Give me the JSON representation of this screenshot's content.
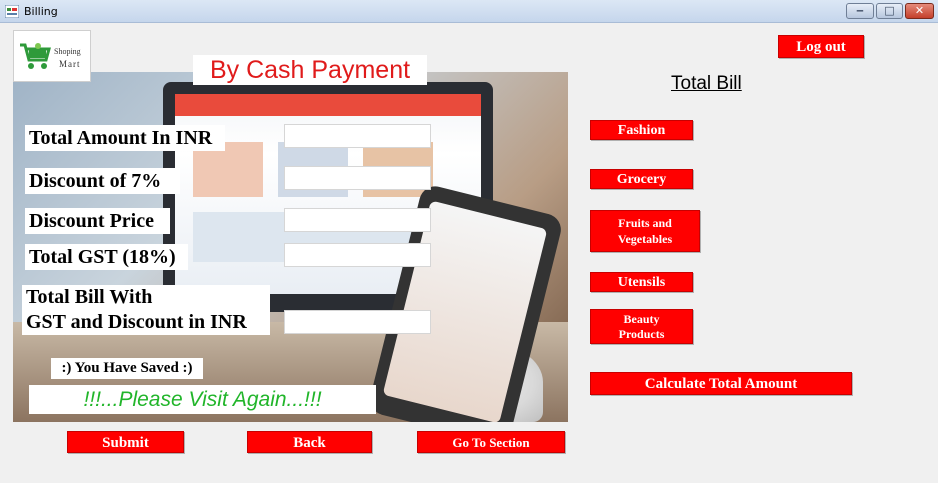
{
  "window": {
    "title": "Billing",
    "min_glyph": "‒",
    "max_glyph": "□",
    "close_glyph": "✕"
  },
  "logo": {
    "line1": "Shoping",
    "line2": "Mart"
  },
  "heading": "By Cash Payment",
  "fields": [
    {
      "label": "Total Amount In INR",
      "value": ""
    },
    {
      "label": "Discount of 7%",
      "value": ""
    },
    {
      "label": "Discount Price",
      "value": ""
    },
    {
      "label": "Total GST (18%)",
      "value": ""
    },
    {
      "label_line1": "Total Bill With",
      "label_line2": "GST and Discount in INR",
      "value": ""
    }
  ],
  "saved_text": ":) You Have Saved :)",
  "visit_text": "!!!...Please Visit Again...!!!",
  "buttons": {
    "submit": "Submit",
    "back": "Back",
    "go_to_section": "Go To Section",
    "logout": "Log out",
    "calculate": "Calculate Total Amount"
  },
  "total_bill_heading": "Total Bill",
  "categories": {
    "fashion": "Fashion",
    "grocery": "Grocery",
    "fruits_line1": "Fruits and",
    "fruits_line2": "Vegetables",
    "utensils": "Utensils",
    "beauty_line1": "Beauty",
    "beauty_line2": "Products"
  },
  "colors": {
    "accent_red": "#ff0000",
    "heading_red": "#e01b1b",
    "visit_green": "#21b52a"
  }
}
